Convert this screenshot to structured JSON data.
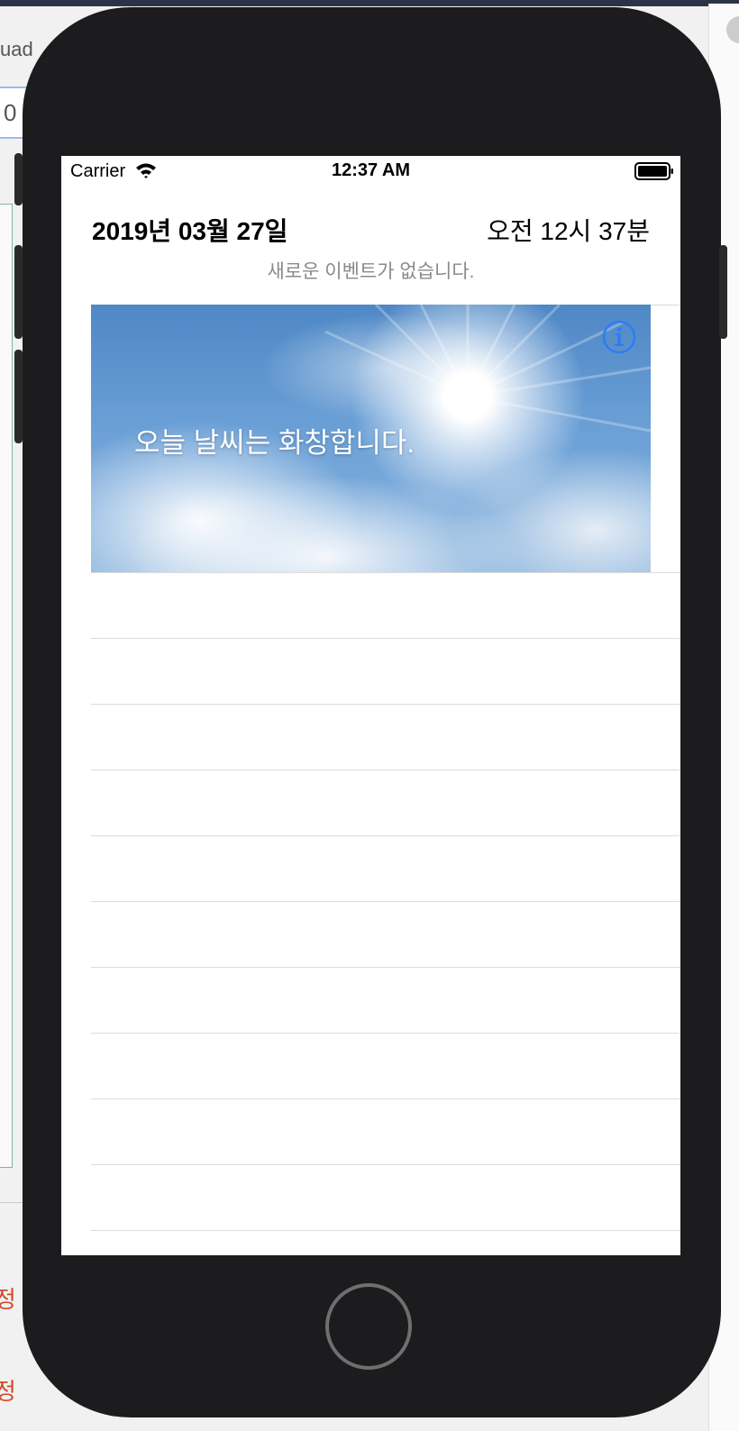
{
  "background": {
    "partial_text_top": "uad",
    "partial_field_text": "0",
    "partial_red_text": [
      "정",
      "정"
    ]
  },
  "status_bar": {
    "carrier": "Carrier",
    "time": "12:37 AM",
    "wifi_icon": "wifi-icon",
    "battery_icon": "battery-icon"
  },
  "header": {
    "date": "2019년 03월 27일",
    "time": "오전 12시 37분",
    "event_message": "새로운 이벤트가 없습니다."
  },
  "weather_card": {
    "message": "오늘 날씨는 화창합니다.",
    "info_icon": "info-icon",
    "accent_color": "#2f7bf5"
  },
  "table": {
    "empty_row_count": 11,
    "separator_color": "#dcdcdc"
  },
  "colors": {
    "phone_body": "#1c1c1e",
    "screen": "#ffffff",
    "sky": "#5b93cf"
  }
}
